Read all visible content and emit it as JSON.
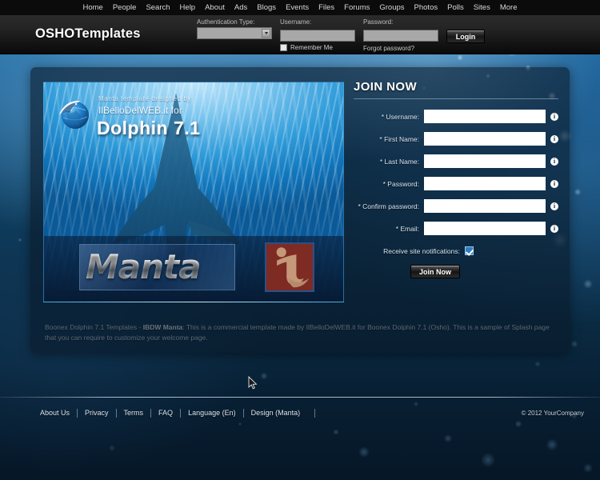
{
  "colors": {
    "nav_bar_bg": "#0b0b0b",
    "header_bg": "#242424",
    "panel_bg": "rgba(10,26,42,0.62)",
    "water_blue": "#2d7ab4",
    "deep_blue": "#061727",
    "accent_checkbox": "#2e7ec4",
    "it_mark_red": "#7d2b23",
    "input_white": "#ffffff"
  },
  "top_nav": {
    "items": [
      {
        "label": "Home",
        "name": "nav-home"
      },
      {
        "label": "People",
        "name": "nav-people"
      },
      {
        "label": "Search",
        "name": "nav-search"
      },
      {
        "label": "Help",
        "name": "nav-help"
      },
      {
        "label": "About",
        "name": "nav-about"
      },
      {
        "label": "Ads",
        "name": "nav-ads"
      },
      {
        "label": "Blogs",
        "name": "nav-blogs"
      },
      {
        "label": "Events",
        "name": "nav-events"
      },
      {
        "label": "Files",
        "name": "nav-files"
      },
      {
        "label": "Forums",
        "name": "nav-forums"
      },
      {
        "label": "Groups",
        "name": "nav-groups"
      },
      {
        "label": "Photos",
        "name": "nav-photos"
      },
      {
        "label": "Polls",
        "name": "nav-polls"
      },
      {
        "label": "Sites",
        "name": "nav-sites"
      },
      {
        "label": "More",
        "name": "nav-more"
      }
    ]
  },
  "header": {
    "site_title": "OSHOTemplates",
    "login": {
      "auth_type_label": "Authentication Type:",
      "auth_type_value": "",
      "username_label": "Username:",
      "username_value": "",
      "username_placeholder": "",
      "password_label": "Password:",
      "password_value": "",
      "password_placeholder": "",
      "remember_label": "Remember Me",
      "remember_checked": false,
      "forgot_password_label": "Forgot password?",
      "login_button_label": "Login"
    }
  },
  "splash": {
    "credit_line1": "Manta template designed by",
    "credit_line2": "IlBelloDelWEB.it for",
    "title": "Dolphin 7.1",
    "wordmark": "Manta",
    "mark_label": "it"
  },
  "join": {
    "title": "JOIN NOW",
    "fields": [
      {
        "label": "* Username:",
        "value": "",
        "name": "join-username",
        "icon": "info-icon"
      },
      {
        "label": "* First Name:",
        "value": "",
        "name": "join-first-name",
        "icon": "info-icon"
      },
      {
        "label": "* Last Name:",
        "value": "",
        "name": "join-last-name",
        "icon": "info-icon"
      },
      {
        "label": "* Password:",
        "value": "",
        "name": "join-password",
        "icon": "info-icon"
      },
      {
        "label": "* Confirm password:",
        "value": "",
        "name": "join-confirm-password",
        "icon": "info-icon"
      },
      {
        "label": "* Email:",
        "value": "",
        "name": "join-email",
        "icon": "info-icon"
      }
    ],
    "info_icon_glyph": "i",
    "notifications_label": "Receive site notifications:",
    "notifications_checked": true,
    "submit_label": "Join Now"
  },
  "description": {
    "prefix": "Boonex Dolphin 7.1 Templates - ",
    "bold": "IBDW Manta",
    "body": ": This is a commercial template made by IlBelloDelWEB.it for Boonex Dolphin 7.1 (Osho). This is a sample of Splash page that you can require to customize your welcome page."
  },
  "footer": {
    "links": [
      {
        "label": "About Us",
        "name": "footer-about-us"
      },
      {
        "label": "Privacy",
        "name": "footer-privacy"
      },
      {
        "label": "Terms",
        "name": "footer-terms"
      },
      {
        "label": "FAQ",
        "name": "footer-faq"
      },
      {
        "label": "Language (En)",
        "name": "footer-language"
      },
      {
        "label": "Design (Manta)",
        "name": "footer-design"
      }
    ],
    "copyright": "© 2012 YourCompany"
  }
}
